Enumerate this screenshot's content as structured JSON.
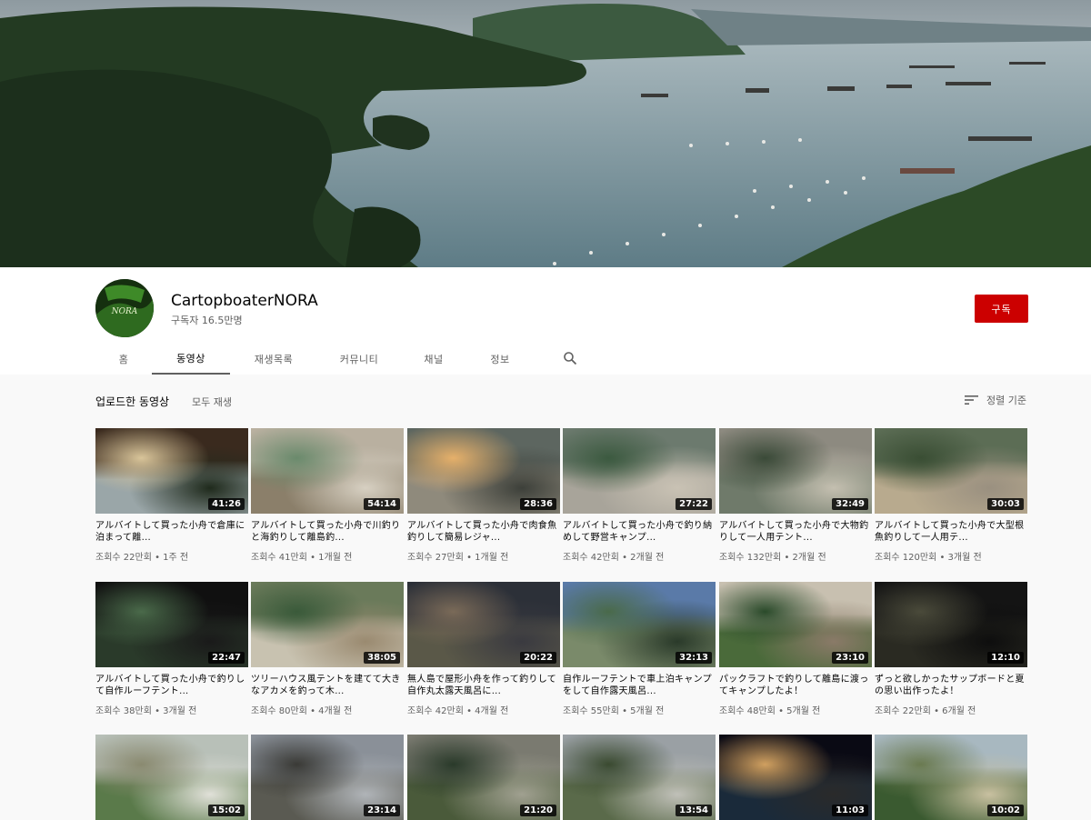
{
  "channel": {
    "name": "CartopboaterNORA",
    "subscribers": "구독자 16.5만명",
    "avatar_text": "CartopboaterNORA",
    "subscribe_label": "구독"
  },
  "tabs": [
    {
      "label": "홈"
    },
    {
      "label": "동영상"
    },
    {
      "label": "재생목록"
    },
    {
      "label": "커뮤니티"
    },
    {
      "label": "채널"
    },
    {
      "label": "정보"
    }
  ],
  "section": {
    "title": "업로드한 동영상",
    "play_all": "모두 재생",
    "sort_label": "정렬 기준"
  },
  "videos": [
    {
      "title": "アルバイトして買った小舟で倉庫に泊まって離...",
      "views": "조회수 22만회",
      "ago": "1주 전",
      "duration": "41:26"
    },
    {
      "title": "アルバイトして買った小舟で川釣りと海釣りして離島釣...",
      "views": "조회수 41만회",
      "ago": "1개월 전",
      "duration": "54:14"
    },
    {
      "title": "アルバイトして買った小舟で肉食魚釣りして簡易レジャ...",
      "views": "조회수 27만회",
      "ago": "1개월 전",
      "duration": "28:36"
    },
    {
      "title": "アルバイトして買った小舟で釣り納めして野営キャンプ...",
      "views": "조회수 42만회",
      "ago": "2개월 전",
      "duration": "27:22"
    },
    {
      "title": "アルバイトして買った小舟で大物釣りして一人用テント...",
      "views": "조회수 132만회",
      "ago": "2개월 전",
      "duration": "32:49"
    },
    {
      "title": "アルバイトして買った小舟で大型根魚釣りして一人用テ...",
      "views": "조회수 120만회",
      "ago": "3개월 전",
      "duration": "30:03"
    },
    {
      "title": "アルバイトして買った小舟で釣りして自作ルーフテント...",
      "views": "조회수 38만회",
      "ago": "3개월 전",
      "duration": "22:47"
    },
    {
      "title": "ツリーハウス風テントを建てて大きなアカメを釣って木...",
      "views": "조회수 80만회",
      "ago": "4개월 전",
      "duration": "38:05"
    },
    {
      "title": "無人島で屋形小舟を作って釣りして自作丸太露天風呂に...",
      "views": "조회수 42만회",
      "ago": "4개월 전",
      "duration": "20:22"
    },
    {
      "title": "自作ルーフテントで車上泊キャンプをして自作露天風呂...",
      "views": "조회수 55만회",
      "ago": "5개월 전",
      "duration": "32:13"
    },
    {
      "title": "パックラフトで釣りして離島に渡ってキャンプしたよ！",
      "views": "조회수 48만회",
      "ago": "5개월 전",
      "duration": "23:10"
    },
    {
      "title": "ずっと欲しかったサップボードと夏の思い出作ったよ！",
      "views": "조회수 22만회",
      "ago": "6개월 전",
      "duration": "12:10"
    },
    {
      "title": "",
      "views": "",
      "ago": "",
      "duration": "15:02"
    },
    {
      "title": "",
      "views": "",
      "ago": "",
      "duration": "23:14"
    },
    {
      "title": "",
      "views": "",
      "ago": "",
      "duration": "21:20"
    },
    {
      "title": "",
      "views": "",
      "ago": "",
      "duration": "13:54"
    },
    {
      "title": "",
      "views": "",
      "ago": "",
      "duration": "11:03"
    },
    {
      "title": "",
      "views": "",
      "ago": "",
      "duration": "10:02"
    }
  ],
  "icons": {
    "search_tab": "search-icon",
    "sort": "sort-icon"
  },
  "colors": {
    "subscribe": "#cc0000"
  }
}
